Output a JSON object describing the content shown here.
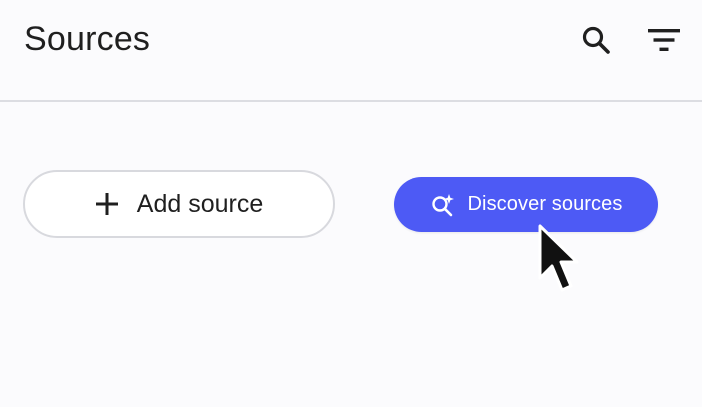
{
  "header": {
    "title": "Sources",
    "icons": [
      "search-icon",
      "filter-icon"
    ]
  },
  "actions": {
    "add_source_label": "Add source",
    "add_source_icon": "plus-icon",
    "discover_label": "Discover sources",
    "discover_icon": "sparkle-search-icon"
  },
  "colors": {
    "accent": "#4d5af5",
    "background": "#fbfbfd",
    "divider": "#dcdde2",
    "text": "#1f1f1f"
  }
}
